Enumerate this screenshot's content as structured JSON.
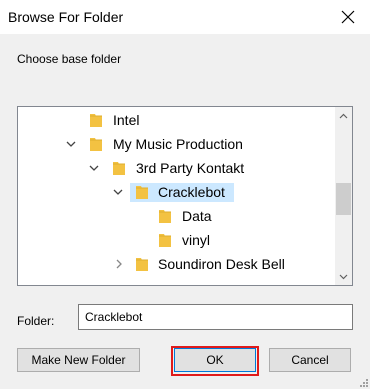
{
  "window": {
    "title": "Browse For Folder"
  },
  "description": "Choose base folder",
  "tree": {
    "items": [
      {
        "label": "Intel",
        "expandable": false,
        "expanded": false
      },
      {
        "label": "My Music Production",
        "expandable": true,
        "expanded": true
      },
      {
        "label": "3rd Party Kontakt",
        "expandable": true,
        "expanded": true
      },
      {
        "label": "Cracklebot",
        "expandable": true,
        "expanded": true,
        "selected": true
      },
      {
        "label": "Data",
        "expandable": false,
        "expanded": false
      },
      {
        "label": "vinyl",
        "expandable": false,
        "expanded": false
      },
      {
        "label": "Soundiron Desk Bell",
        "expandable": true,
        "expanded": false
      }
    ]
  },
  "folder_field": {
    "label": "Folder:",
    "value": "Cracklebot"
  },
  "buttons": {
    "new_folder": "Make New Folder",
    "ok": "OK",
    "cancel": "Cancel"
  },
  "colors": {
    "folder": "#f3c242",
    "selection": "#cce8ff",
    "highlight": "#e01b1b"
  }
}
